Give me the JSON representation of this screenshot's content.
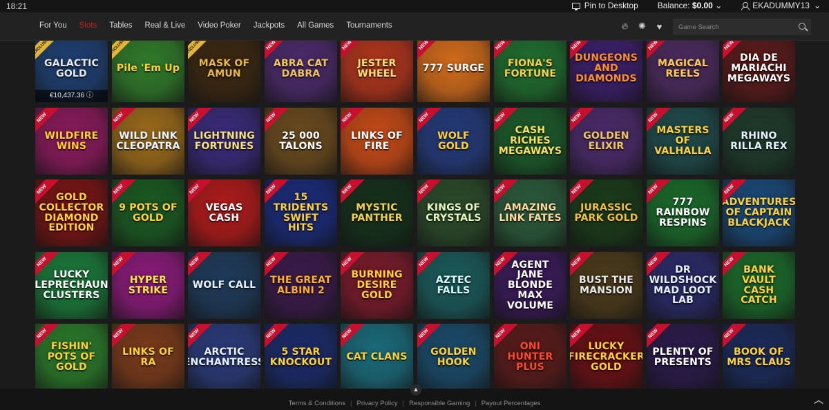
{
  "status": {
    "time": "18:21",
    "pin_label": "Pin to Desktop",
    "balance_label": "Balance: ",
    "balance_value": "$0.00",
    "username": "EKADUMMY13"
  },
  "nav": {
    "tabs": [
      "For You",
      "Slots",
      "Tables",
      "Real & Live",
      "Video Poker",
      "Jackpots",
      "All Games",
      "Tournaments"
    ],
    "active_tab": "Slots",
    "search_placeholder": "Game Search",
    "icons": [
      "flame-icon",
      "poker-chip-icon",
      "heart-icon"
    ]
  },
  "badges": {
    "new": "NEW",
    "exclusive": "EXCLUSIVE"
  },
  "games": [
    [
      {
        "title": "GALACTIC GOLD",
        "badge": "exclusive",
        "jackpot": "€10,437.36",
        "bg": "#1d3f72",
        "fg": "#e8e8e8"
      },
      {
        "title": "Pile 'Em Up",
        "badge": "exclusive",
        "bg": "#2f7a2a",
        "fg": "#ffd23a"
      },
      {
        "title": "MASK OF AMUN",
        "badge": "exclusive",
        "bg": "#3a2710",
        "fg": "#e8b84a"
      },
      {
        "title": "ABRA CAT DABRA",
        "badge": "new",
        "bg": "#4a2a6a",
        "fg": "#f0c75e"
      },
      {
        "title": "JESTER WHEEL",
        "badge": "new",
        "bg": "#b0351c",
        "fg": "#ffe07a"
      },
      {
        "title": "777 SURGE",
        "badge": "new",
        "bg": "#d16b1b",
        "fg": "#ffffff"
      },
      {
        "title": "FIONA'S FORTUNE",
        "badge": "new",
        "bg": "#1f6d2f",
        "fg": "#f5d24b"
      },
      {
        "title": "DUNGEONS AND DIAMONDS",
        "badge": "new",
        "bg": "#3b1e6a",
        "fg": "#ff8f2b"
      },
      {
        "title": "MAGICAL REELS",
        "badge": "new",
        "bg": "#4b2a5e",
        "fg": "#ffcc55"
      },
      {
        "title": "DIA DE MARIACHI MEGAWAYS",
        "badge": "new",
        "bg": "#5a1a1a",
        "fg": "#ffffff"
      }
    ],
    [
      {
        "title": "WILDFIRE WINS",
        "badge": "new",
        "bg": "#8a1a5c",
        "fg": "#ffcf2e"
      },
      {
        "title": "WILD LINK CLEOPATRA",
        "badge": "new",
        "bg": "#9a6a1a",
        "fg": "#eaf5ff"
      },
      {
        "title": "LIGHTNING FORTUNES",
        "badge": "new",
        "bg": "#3a2a7a",
        "fg": "#f6e27a"
      },
      {
        "title": "25 000 TALONS",
        "badge": "new",
        "bg": "#6a4a1e",
        "fg": "#ffffff"
      },
      {
        "title": "LINKS OF FIRE",
        "badge": "new",
        "bg": "#c64a16",
        "fg": "#ffffff"
      },
      {
        "title": "WOLF GOLD",
        "badge": "new",
        "bg": "#233a7a",
        "fg": "#ffd23a"
      },
      {
        "title": "CASH RICHES MEGAWAYS",
        "badge": "new",
        "bg": "#1b5a2a",
        "fg": "#f7e05a"
      },
      {
        "title": "GOLDEN ELIXIR",
        "badge": "new",
        "bg": "#4a2a6a",
        "fg": "#f0c75e"
      },
      {
        "title": "MASTERS OF VALHALLA",
        "badge": "new",
        "bg": "#1f4a4a",
        "fg": "#ffd23a"
      },
      {
        "title": "RHINO RILLA REX",
        "badge": "new",
        "bg": "#1e3a2a",
        "fg": "#e6f2ff"
      }
    ],
    [
      {
        "title": "GOLD COLLECTOR DIAMOND EDITION",
        "badge": "new",
        "bg": "#7a1414",
        "fg": "#ffd23a"
      },
      {
        "title": "9 POTS OF GOLD",
        "badge": "new",
        "bg": "#1a5a22",
        "fg": "#ffd23a"
      },
      {
        "title": "VEGAS CASH",
        "badge": "new",
        "bg": "#b01a1a",
        "fg": "#ffffff"
      },
      {
        "title": "15 TRIDENTS SWIFT HITS",
        "badge": "new",
        "bg": "#1a2a7a",
        "fg": "#ffd23a"
      },
      {
        "title": "MYSTIC PANTHER",
        "badge": "new",
        "bg": "#14301a",
        "fg": "#f5d24b"
      },
      {
        "title": "KINGS OF CRYSTALS",
        "badge": "new",
        "bg": "#2a4a2a",
        "fg": "#e7f7c0"
      },
      {
        "title": "AMAZING LINK FATES",
        "badge": "new",
        "bg": "#2a5a3a",
        "fg": "#ffd9a0"
      },
      {
        "title": "JURASSIC PARK GOLD",
        "badge": "new",
        "bg": "#1a3a1a",
        "fg": "#f0c040"
      },
      {
        "title": "777 RAINBOW RESPINS",
        "badge": "new",
        "bg": "#1a6a2a",
        "fg": "#ffffff"
      },
      {
        "title": "ADVENTURES OF CAPTAIN BLACKJACK",
        "badge": "new",
        "bg": "#1a4a7a",
        "fg": "#ffd23a"
      }
    ],
    [
      {
        "title": "LUCKY LEPRECHAUN CLUSTERS",
        "badge": "new",
        "bg": "#1a7a3a",
        "fg": "#ffffff"
      },
      {
        "title": "HYPER STRIKE",
        "badge": "new",
        "bg": "#8a1a7a",
        "fg": "#ffe64a"
      },
      {
        "title": "WOLF CALL",
        "badge": "new",
        "bg": "#1e3a5a",
        "fg": "#e6f2ff"
      },
      {
        "title": "THE GREAT ALBINI 2",
        "badge": "new",
        "bg": "#3a1a4a",
        "fg": "#ffb02e"
      },
      {
        "title": "BURNING DESIRE GOLD",
        "badge": "new",
        "bg": "#7a1a2a",
        "fg": "#ffd23a"
      },
      {
        "title": "AZTEC FALLS",
        "badge": "new",
        "bg": "#1a5a5a",
        "fg": "#d8fbff"
      },
      {
        "title": "AGENT JANE BLONDE MAX VOLUME",
        "badge": "new",
        "bg": "#3a1a5a",
        "fg": "#ffffff"
      },
      {
        "title": "BUST THE MANSION",
        "badge": "new",
        "bg": "#4a3a1a",
        "fg": "#e8e8e8"
      },
      {
        "title": "DR WILDSHOCK MAD LOOT LAB",
        "badge": "new",
        "bg": "#2a2a6a",
        "fg": "#e6f2ff"
      },
      {
        "title": "BANK VAULT CASH CATCH",
        "badge": "new",
        "bg": "#1a6a2a",
        "fg": "#ffd23a"
      }
    ],
    [
      {
        "title": "FISHIN' POTS OF GOLD",
        "badge": "new",
        "bg": "#2a7a2a",
        "fg": "#ffd23a"
      },
      {
        "title": "LINKS OF RA",
        "badge": "new",
        "bg": "#7a3a1a",
        "fg": "#ffd23a"
      },
      {
        "title": "ARCTIC ENCHANTRESS",
        "badge": "new",
        "bg": "#2a3a7a",
        "fg": "#e6f2ff"
      },
      {
        "title": "5 STAR KNOCKOUT",
        "badge": "new",
        "bg": "#1a2a6a",
        "fg": "#ffd23a"
      },
      {
        "title": "CAT CLANS",
        "badge": "new",
        "bg": "#1a6a7a",
        "fg": "#ffd23a"
      },
      {
        "title": "GOLDEN HOOK",
        "badge": "new",
        "bg": "#1a4a6a",
        "fg": "#ffd23a"
      },
      {
        "title": "ONI HUNTER PLUS",
        "badge": "new",
        "bg": "#5a1a1a",
        "fg": "#ff4a2a"
      },
      {
        "title": "LUCKY FIRECRACKER GOLD",
        "badge": "new",
        "bg": "#6a0f14",
        "fg": "#ffd23a"
      },
      {
        "title": "PLENTY OF PRESENTS",
        "badge": "new",
        "bg": "#2a1a4a",
        "fg": "#ffffff"
      },
      {
        "title": "BOOK OF MRS CLAUS",
        "badge": "new",
        "bg": "#1a2a5a",
        "fg": "#ffd23a"
      }
    ]
  ],
  "footer": {
    "links": [
      "Terms & Conditions",
      "Privacy Policy",
      "Responsible Gaming",
      "Payout Percentages"
    ]
  }
}
